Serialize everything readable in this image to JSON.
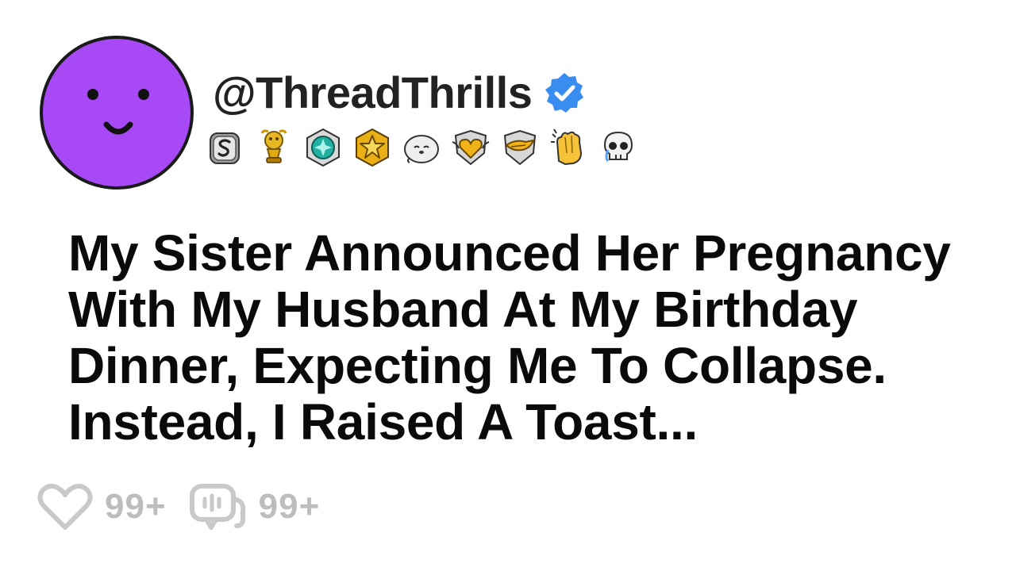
{
  "post": {
    "author": {
      "handle": "@ThreadThrills",
      "verified": true,
      "avatar_color": "#a74af5"
    },
    "badges": [
      "silver-s-badge-icon",
      "gold-trophy-badge-icon",
      "teal-gem-badge-icon",
      "gold-star-badge-icon",
      "seal-badge-icon",
      "gold-heart-shield-badge-icon",
      "wings-shield-badge-icon",
      "clapping-hands-badge-icon",
      "skull-crying-badge-icon"
    ],
    "title": "My Sister Announced Her Pregnancy With My Husband At My Birthday Dinner, Expecting Me To Collapse. Instead, I Raised A Toast...",
    "stats": {
      "likes": "99+",
      "comments": "99+"
    }
  },
  "colors": {
    "verified_blue": "#3a8df0",
    "stat_gray": "#bdbdbd",
    "title_black": "#0a0a0a"
  }
}
